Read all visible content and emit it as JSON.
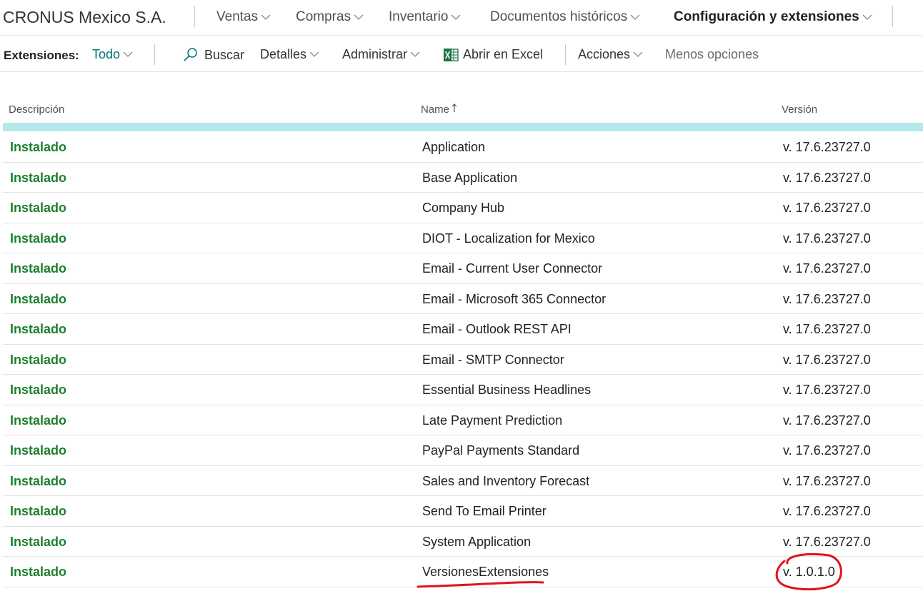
{
  "topnav": {
    "company": "CRONUS Mexico S.A.",
    "items": [
      {
        "label": "Ventas"
      },
      {
        "label": "Compras"
      },
      {
        "label": "Inventario"
      },
      {
        "label": "Documentos históricos"
      },
      {
        "label": "Configuración y extensiones",
        "active": true
      }
    ]
  },
  "actionbar": {
    "title": "Extensiones:",
    "filter": "Todo",
    "search": "Buscar",
    "details": "Detalles",
    "manage": "Administrar",
    "excel": "Abrir en Excel",
    "actions": "Acciones",
    "fewer_options": "Menos opciones"
  },
  "columns": {
    "description": "Descripción",
    "name": "Name",
    "version": "Versión"
  },
  "rows": [
    {
      "status": "Instalado",
      "name": "Application",
      "version": "v. 17.6.23727.0"
    },
    {
      "status": "Instalado",
      "name": "Base Application",
      "version": "v. 17.6.23727.0"
    },
    {
      "status": "Instalado",
      "name": "Company Hub",
      "version": "v. 17.6.23727.0"
    },
    {
      "status": "Instalado",
      "name": "DIOT - Localization for Mexico",
      "version": "v. 17.6.23727.0"
    },
    {
      "status": "Instalado",
      "name": "Email - Current User Connector",
      "version": "v. 17.6.23727.0"
    },
    {
      "status": "Instalado",
      "name": "Email - Microsoft 365 Connector",
      "version": "v. 17.6.23727.0"
    },
    {
      "status": "Instalado",
      "name": "Email - Outlook REST API",
      "version": "v. 17.6.23727.0"
    },
    {
      "status": "Instalado",
      "name": "Email - SMTP Connector",
      "version": "v. 17.6.23727.0"
    },
    {
      "status": "Instalado",
      "name": "Essential Business Headlines",
      "version": "v. 17.6.23727.0"
    },
    {
      "status": "Instalado",
      "name": "Late Payment Prediction",
      "version": "v. 17.6.23727.0"
    },
    {
      "status": "Instalado",
      "name": "PayPal Payments Standard",
      "version": "v. 17.6.23727.0"
    },
    {
      "status": "Instalado",
      "name": "Sales and Inventory Forecast",
      "version": "v. 17.6.23727.0"
    },
    {
      "status": "Instalado",
      "name": "Send To Email Printer",
      "version": "v. 17.6.23727.0"
    },
    {
      "status": "Instalado",
      "name": "System Application",
      "version": "v. 17.6.23727.0"
    },
    {
      "status": "Instalado",
      "name": "VersionesExtensiones",
      "version": "v. 1.0.1.0"
    }
  ],
  "colors": {
    "status_green": "#1e7f2e",
    "accent_teal": "#00717a",
    "selection": "#b5e8ea",
    "annotation_red": "#e0141e"
  },
  "icons": {
    "search": "search-icon",
    "excel": "excel-icon",
    "sort": "sort-ascending-icon",
    "dropdown": "chevron-down-icon"
  }
}
